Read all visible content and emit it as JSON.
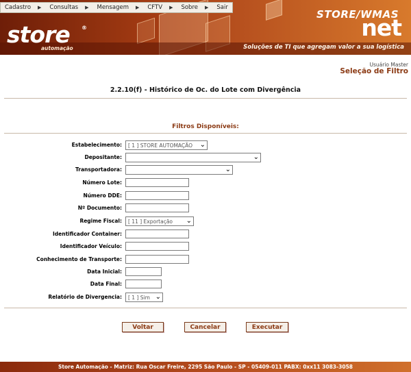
{
  "menu": [
    {
      "label": "Cadastro"
    },
    {
      "label": "Consultas"
    },
    {
      "label": "Mensagem"
    },
    {
      "label": "CFTV"
    },
    {
      "label": "Sobre"
    },
    {
      "label": "Sair"
    }
  ],
  "brand": {
    "logo": "store",
    "logo_mark": "®",
    "logo_sub": "automação",
    "product": "STORE/WMAS",
    "product_net": "net",
    "tagline": "Soluções de TI que agregam valor a sua logística"
  },
  "header": {
    "user": "Usuário Master",
    "subtitle": "Seleção de Filtro",
    "title": "2.2.10(f) - Histórico de Oc. do Lote com Divergência"
  },
  "filters": {
    "section_title": "Filtros Disponíveis:",
    "estabelecimento": {
      "label": "Estabelecimento:",
      "value": "[ 1 ] STORE AUTOMAÇÃO"
    },
    "depositante": {
      "label": "Depositante:",
      "value": ""
    },
    "transportadora": {
      "label": "Transportadora:",
      "value": ""
    },
    "numero_lote": {
      "label": "Número Lote:",
      "value": ""
    },
    "numero_dde": {
      "label": "Número DDE:",
      "value": ""
    },
    "numero_documento": {
      "label": "Nº Documento:",
      "value": ""
    },
    "regime_fiscal": {
      "label": "Regime Fiscal:",
      "value": "[ 11 ] Exportação"
    },
    "identificador_container": {
      "label": "Identificador Container:",
      "value": ""
    },
    "identificador_veiculo": {
      "label": "Identificador Veículo:",
      "value": ""
    },
    "conhecimento_transporte": {
      "label": "Conhecimento de Transporte:",
      "value": ""
    },
    "data_inicial": {
      "label": "Data Inicial:",
      "value": ""
    },
    "data_final": {
      "label": "Data Final:",
      "value": ""
    },
    "relatorio_divergencia": {
      "label": "Relatório de Divergencia:",
      "value": "[ 1 ] Sim"
    }
  },
  "buttons": {
    "voltar": "Voltar",
    "cancelar": "Cancelar",
    "executar": "Executar"
  },
  "footer": "Store Automação - Matriz: Rua Oscar Freire, 2295 São Paulo - SP - 05409-011 PABX: 0xx11 3083-3058",
  "colors": {
    "brand_dark": "#6e1e08",
    "brand_light": "#d87a2c",
    "accent_text": "#8b3a14"
  }
}
